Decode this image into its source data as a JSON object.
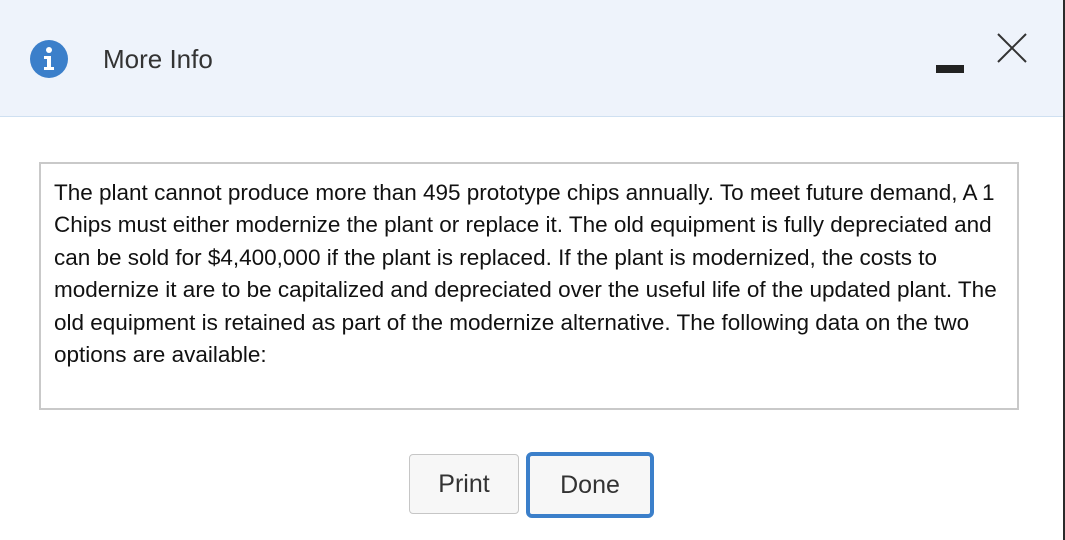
{
  "dialog": {
    "title": "More Info",
    "icons": {
      "info": "info-icon",
      "minimize": "minimize-icon",
      "close": "close-icon"
    }
  },
  "content": {
    "text": "The plant cannot produce more than 495 prototype chips annually. To meet future demand, A 1 Chips must either modernize the plant or replace it. The old equipment is fully depreciated and can be sold for $4,400,000 if the plant is replaced. If the plant is modernized, the costs to modernize it are to be capitalized and depreciated over the useful life of the updated plant. The old equipment is retained as part of the modernize alternative. The following data on the two options are available:"
  },
  "buttons": {
    "print_label": "Print",
    "done_label": "Done"
  },
  "colors": {
    "header_bg": "#eef3fb",
    "accent": "#3b7fca",
    "info_icon": "#3b7fca"
  }
}
